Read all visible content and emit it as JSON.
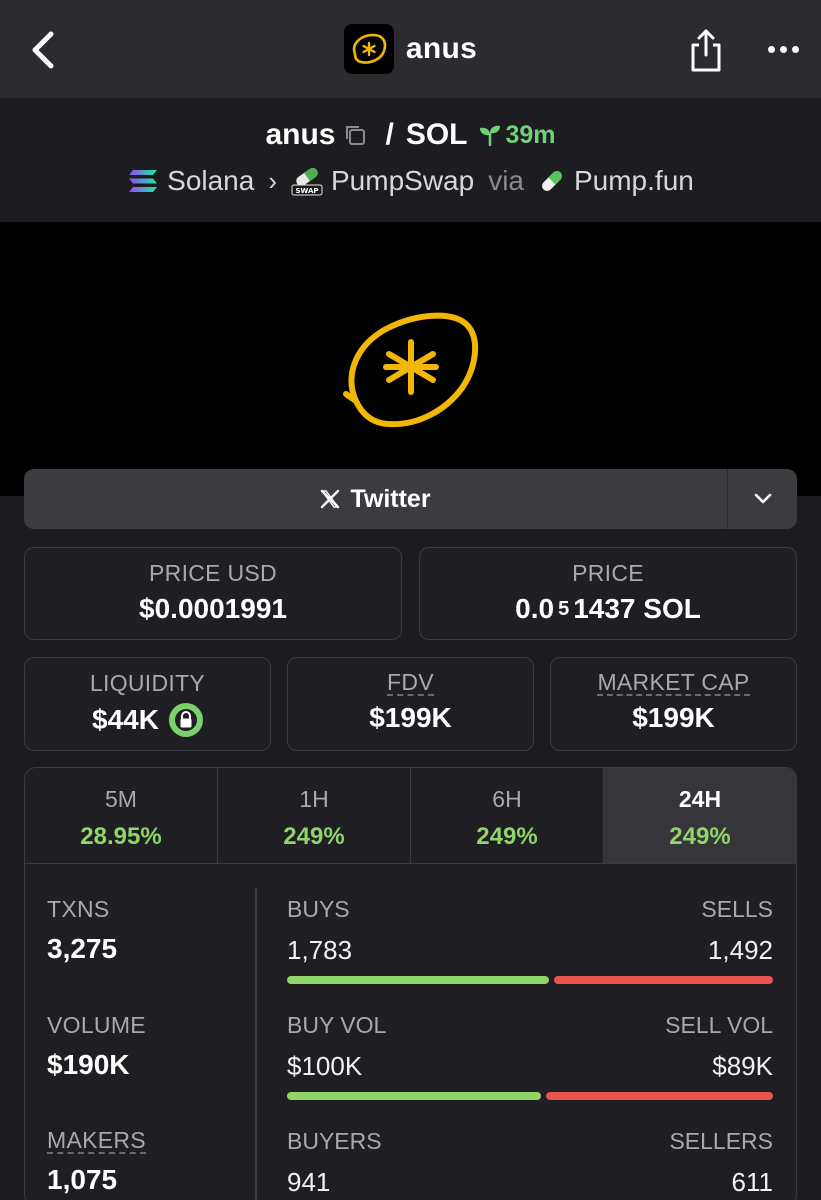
{
  "header": {
    "title": "anus",
    "back_icon": "chevron-left-icon",
    "share_icon": "share-icon",
    "more_icon": "more-dots-icon"
  },
  "pair": {
    "base": "anus",
    "quote": "SOL",
    "separator": "/",
    "age": "39m",
    "chain": "Solana",
    "dex": "PumpSwap",
    "via": "via",
    "launchpad": "Pump.fun"
  },
  "social": {
    "twitter_label": "Twitter"
  },
  "prices": {
    "price_usd_label": "PRICE USD",
    "price_usd": "$0.0001991",
    "price_label": "PRICE",
    "price_prefix": "0.0",
    "price_zeros": "5",
    "price_rest": "1437 SOL"
  },
  "metrics": {
    "liquidity_label": "LIQUIDITY",
    "liquidity": "$44K",
    "fdv_label": "FDV",
    "fdv": "$199K",
    "mcap_label": "MARKET CAP",
    "mcap": "$199K"
  },
  "timeframes": [
    {
      "label": "5M",
      "change": "28.95%"
    },
    {
      "label": "1H",
      "change": "249%"
    },
    {
      "label": "6H",
      "change": "249%"
    },
    {
      "label": "24H",
      "change": "249%",
      "active": true
    }
  ],
  "stats": {
    "txns_label": "TXNS",
    "txns": "3,275",
    "volume_label": "VOLUME",
    "volume": "$190K",
    "makers_label": "MAKERS",
    "makers": "1,075",
    "buys_label": "BUYS",
    "buys": "1,783",
    "sells_label": "SELLS",
    "sells": "1,492",
    "buys_fraction": 0.544,
    "buy_vol_label": "BUY VOL",
    "buy_vol": "$100K",
    "sell_vol_label": "SELL VOL",
    "sell_vol": "$89K",
    "buy_vol_fraction": 0.529,
    "buyers_label": "BUYERS",
    "buyers": "941",
    "sellers_label": "SELLERS",
    "sellers": "611"
  },
  "colors": {
    "green": "#8fd56a",
    "red": "#e9544f",
    "logo_yellow": "#f2b705"
  }
}
